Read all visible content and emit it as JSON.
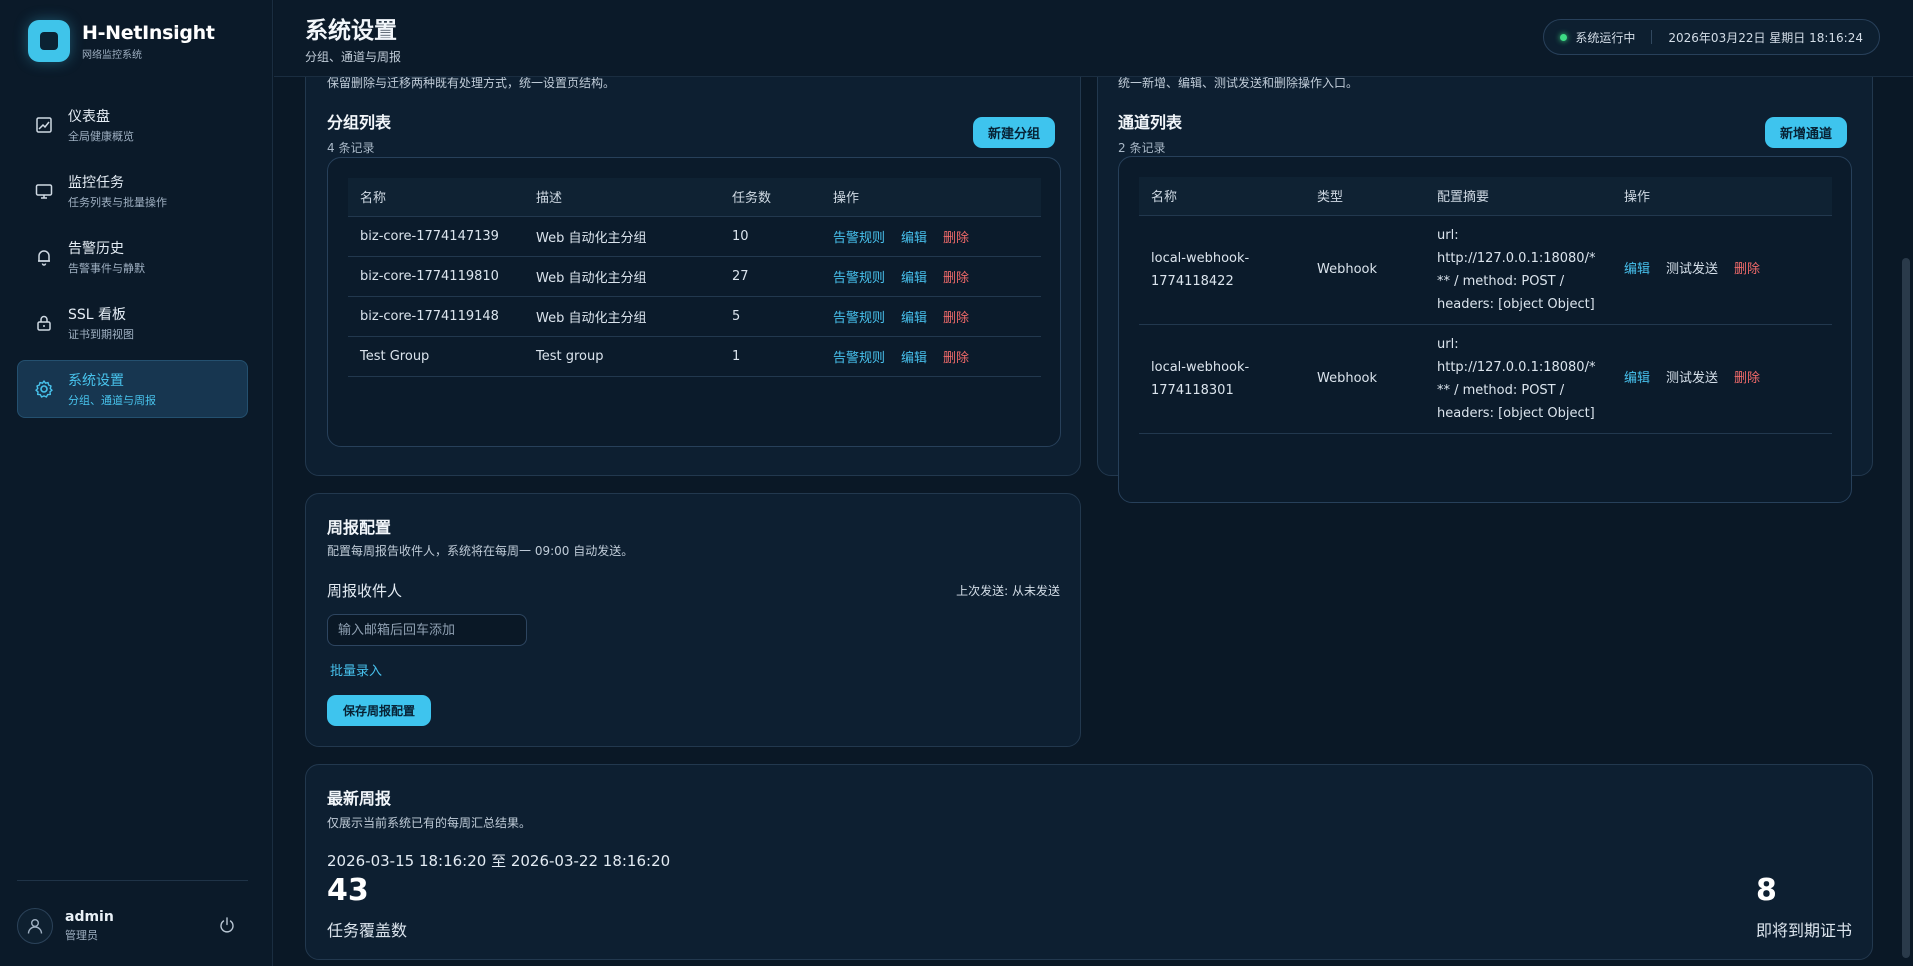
{
  "brand": {
    "name": "H-NetInsight",
    "subtitle": "网络监控系统"
  },
  "nav": [
    {
      "title": "仪表盘",
      "sub": "全局健康概览",
      "icon": "chart-icon"
    },
    {
      "title": "监控任务",
      "sub": "任务列表与批量操作",
      "icon": "monitor-icon"
    },
    {
      "title": "告警历史",
      "sub": "告警事件与静默",
      "icon": "bell-icon"
    },
    {
      "title": "SSL 看板",
      "sub": "证书到期视图",
      "icon": "lock-icon"
    },
    {
      "title": "系统设置",
      "sub": "分组、通道与周报",
      "icon": "gear-icon",
      "active": true
    }
  ],
  "user": {
    "name": "admin",
    "role": "管理员"
  },
  "header": {
    "title": "系统设置",
    "subtitle": "分组、通道与周报",
    "status": "系统运行中",
    "datetime": "2026年03月22日 星期日 18:16:24"
  },
  "groups": {
    "top_note": "保留删除与迁移两种既有处理方式，统一设置页结构。",
    "title": "分组列表",
    "count": "4 条记录",
    "new_button": "新建分组",
    "columns": [
      "名称",
      "描述",
      "任务数",
      "操作"
    ],
    "rows": [
      {
        "name": "biz-core-1774147139",
        "desc": "Web 自动化主分组",
        "tasks": "10"
      },
      {
        "name": "biz-core-1774119810",
        "desc": "Web 自动化主分组",
        "tasks": "27"
      },
      {
        "name": "biz-core-1774119148",
        "desc": "Web 自动化主分组",
        "tasks": "5"
      },
      {
        "name": "Test Group",
        "desc": "Test group",
        "tasks": "1"
      }
    ],
    "actions": {
      "rules": "告警规则",
      "edit": "编辑",
      "delete": "删除"
    }
  },
  "channels": {
    "top_note": "统一新增、编辑、测试发送和删除操作入口。",
    "title": "通道列表",
    "count": "2 条记录",
    "new_button": "新增通道",
    "columns": [
      "名称",
      "类型",
      "配置摘要",
      "操作"
    ],
    "rows": [
      {
        "name_line1": "local-webhook-",
        "name_line2": "1774118422",
        "type": "Webhook",
        "summary": [
          "url:",
          "http://127.0.0.1:18080/*",
          "** / method: POST /",
          "headers: [object Object]"
        ]
      },
      {
        "name_line1": "local-webhook-",
        "name_line2": "1774118301",
        "type": "Webhook",
        "summary": [
          "url:",
          "http://127.0.0.1:18080/*",
          "** / method: POST /",
          "headers: [object Object]"
        ]
      }
    ],
    "actions": {
      "edit": "编辑",
      "test": "测试发送",
      "delete": "删除"
    }
  },
  "weekly_config": {
    "title": "周报配置",
    "desc": "配置每周报告收件人，系统将在每周一 09:00 自动发送。",
    "recipients_label": "周报收件人",
    "last_sent": "上次发送: 从未发送",
    "input_placeholder": "输入邮箱后回车添加",
    "bulk_link": "批量录入",
    "save_button": "保存周报配置"
  },
  "latest_report": {
    "title": "最新周报",
    "desc": "仅展示当前系统已有的每周汇总结果。",
    "range": "2026-03-15 18:16:20 至 2026-03-22 18:16:20",
    "metric_left": {
      "value": "43",
      "label": "任务覆盖数"
    },
    "metric_right": {
      "value": "8",
      "label": "即将到期证书"
    }
  }
}
